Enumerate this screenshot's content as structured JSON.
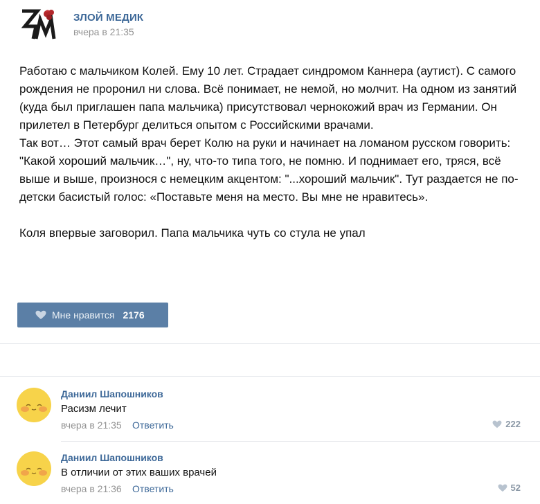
{
  "post": {
    "author": "ЗЛОЙ МЕДИК",
    "time": "вчера в 21:35",
    "text": "Работаю с мальчиком Колей. Ему 10 лет. Страдает синдромом Каннера (аутист). С самого рождения не проронил ни слова. Всё понимает, не немой, но молчит. На одном из занятий (куда был приглашен папа мальчика) присутствовал чернокожий врач из Германии. Он прилетел в Петербург делиться опытом с Российскими врачами.\nТак вот… Этот самый врач берет Колю на руки и начинает на ломаном русском говорить: \"Какой хороший мальчик…\", ну, что-то типа того, не помню. И поднимает его, тряся, всё выше и выше, произнося с немецким акцентом: \"...хороший мальчик\". Тут раздается не по-детски басистый голос: «Поставьте меня на место. Вы мне не нравитесь».\n\nКоля впервые заговорил. Папа мальчика чуть со стула не упал",
    "like_label": "Мне нравится",
    "like_count": "2176",
    "like_color": "#5b7fa6"
  },
  "comments": [
    {
      "name": "Даниил Шапошников",
      "text": "Расизм лечит",
      "time": "вчера в 21:35",
      "reply": "Ответить",
      "likes": "222"
    },
    {
      "name": "Даниил Шапошников",
      "text": "В отличии от этих ваших врачей",
      "time": "вчера в 21:36",
      "reply": "Ответить",
      "likes": "52"
    }
  ],
  "icons": {
    "logo": "community-logo-icon",
    "heart": "heart-icon",
    "avatar": "smiley-face-icon"
  },
  "colors": {
    "link": "#3d6898",
    "meta": "#939393"
  }
}
